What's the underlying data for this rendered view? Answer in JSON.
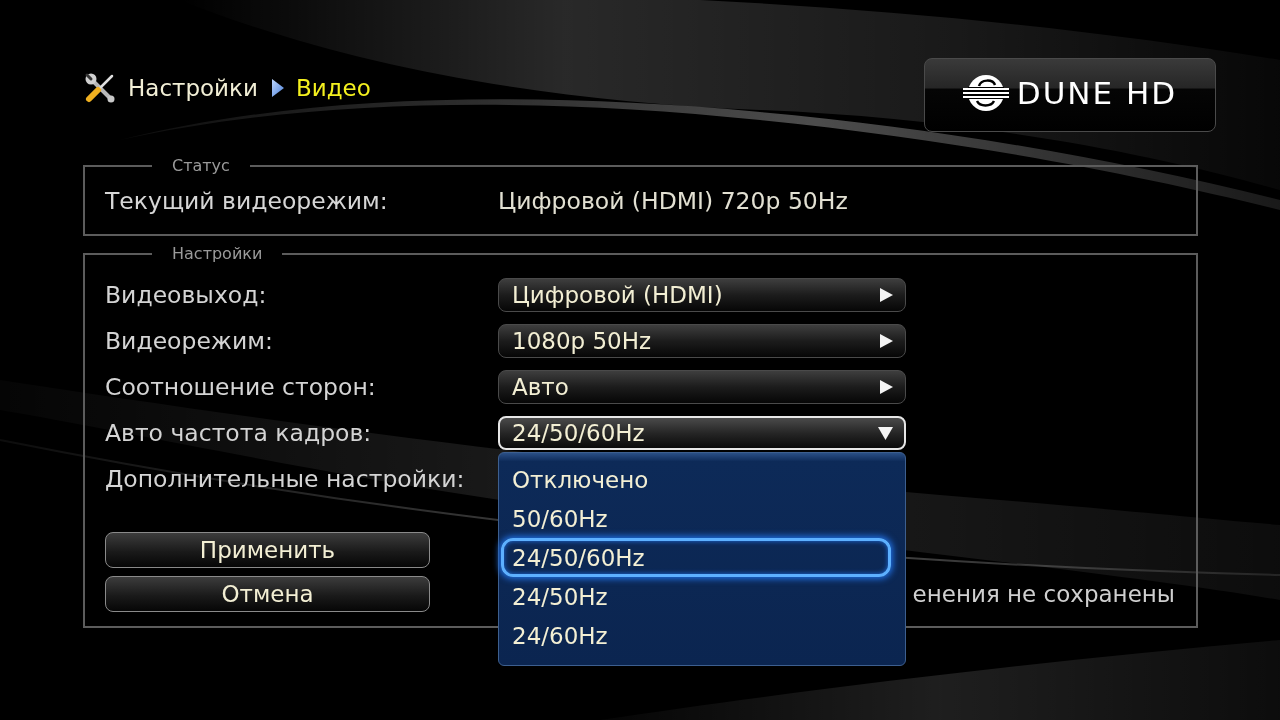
{
  "header": {
    "breadcrumb": [
      {
        "label": "Настройки",
        "current": false
      },
      {
        "label": "Видео",
        "current": true
      }
    ],
    "logo": {
      "text": "DUNE HD"
    }
  },
  "status_panel": {
    "legend": "Статус",
    "rows": [
      {
        "label": "Текущий видеорежим:",
        "value": "Цифровой (HDMI) 720p 50Hz"
      }
    ]
  },
  "settings_panel": {
    "legend": "Настройки",
    "settings": [
      {
        "kind": "select",
        "label": "Видеовыход:",
        "value": "Цифровой (HDMI)",
        "expanded": false
      },
      {
        "kind": "select",
        "label": "Видеорежим:",
        "value": "1080p 50Hz",
        "expanded": false
      },
      {
        "kind": "select",
        "label": "Соотношение сторон:",
        "value": "Авто",
        "expanded": false
      },
      {
        "kind": "select",
        "label": "Авто частота кадров:",
        "value": "24/50/60Hz",
        "expanded": true,
        "options": [
          {
            "label": "Отключено",
            "selected": false
          },
          {
            "label": "50/60Hz",
            "selected": false
          },
          {
            "label": "24/50/60Hz",
            "selected": true
          },
          {
            "label": "24/50Hz",
            "selected": false
          },
          {
            "label": "24/60Hz",
            "selected": false
          }
        ]
      },
      {
        "kind": "label",
        "label": "Дополнительные настройки:"
      }
    ],
    "buttons": [
      "Применить",
      "Отмена"
    ],
    "message": "енения не сохранены"
  }
}
